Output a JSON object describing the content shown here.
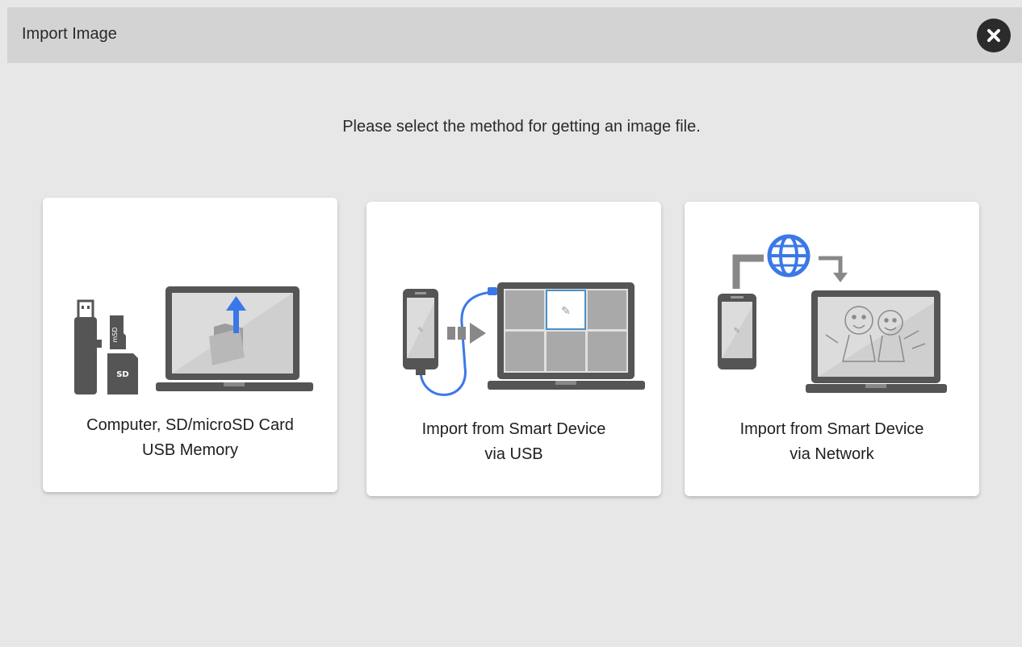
{
  "dialog": {
    "title": "Import Image",
    "close_icon": "close-circle-icon"
  },
  "instruction": "Please select the method for getting an image file.",
  "options": [
    {
      "line1": "Computer, SD/microSD Card",
      "line2": "USB Memory",
      "icons": [
        "usb-stick-icon",
        "microsd-card-icon",
        "sd-card-icon",
        "laptop-icon",
        "folder-upload-icon"
      ]
    },
    {
      "line1": "Import from Smart Device",
      "line2": "via USB",
      "icons": [
        "smartphone-icon",
        "usb-cable-icon",
        "arrow-right-icon",
        "laptop-grid-icon"
      ]
    },
    {
      "line1": "Import from Smart Device",
      "line2": "via Network",
      "icons": [
        "globe-icon",
        "smartphone-icon",
        "laptop-icon",
        "drawing-icon"
      ]
    }
  ],
  "colors": {
    "accent_blue": "#3b78e7",
    "device_dark": "#555555",
    "screen_gray": "#a9a9a9",
    "card_bg": "#ffffff",
    "page_bg": "#e7e7e7",
    "titlebar_bg": "#d3d3d3"
  }
}
